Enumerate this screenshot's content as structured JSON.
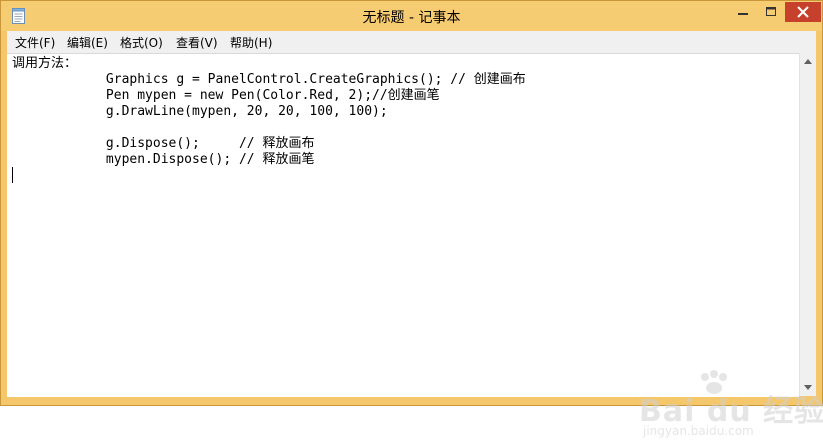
{
  "window": {
    "title": "无标题 - 记事本"
  },
  "menu": {
    "items": [
      {
        "label": "文件(F)"
      },
      {
        "label": "编辑(E)"
      },
      {
        "label": "格式(O)"
      },
      {
        "label": "查看(V)"
      },
      {
        "label": "帮助(H)"
      }
    ]
  },
  "editor": {
    "content": "调用方法：\n            Graphics g = PanelControl.CreateGraphics(); // 创建画布\n            Pen mypen = new Pen(Color.Red, 2);//创建画笔\n            g.DrawLine(mypen, 20, 20, 100, 100);\n\n            g.Dispose();     // 释放画布\n            mypen.Dispose(); // 释放画笔"
  },
  "watermark": {
    "brand": "Bai du 经验",
    "url": "jingyan.baidu.com"
  },
  "colors": {
    "frame": "#f4c76a",
    "close_button": "#c7402b",
    "menubar": "#f0f0f0"
  }
}
